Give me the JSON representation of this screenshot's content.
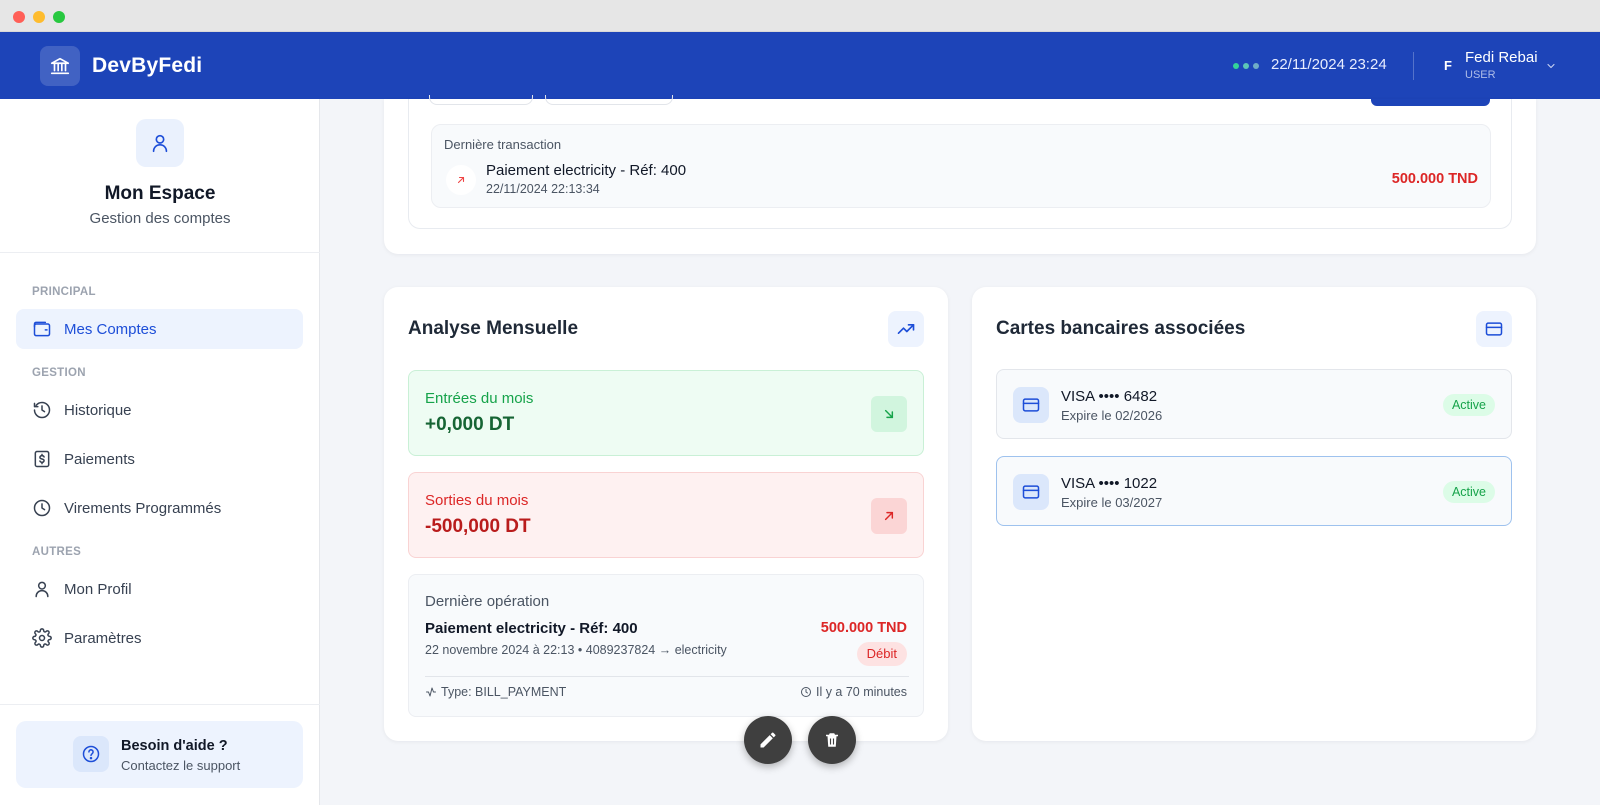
{
  "header": {
    "brand": "DevByFedi",
    "datetime": "22/11/2024 23:24",
    "user_initial": "F",
    "user_name": "Fedi Rebai",
    "user_role": "USER"
  },
  "sidebar": {
    "title": "Mon Espace",
    "subtitle": "Gestion des comptes",
    "sections": {
      "principal": "PRINCIPAL",
      "gestion": "GESTION",
      "autres": "AUTRES"
    },
    "items": {
      "comptes": "Mes Comptes",
      "historique": "Historique",
      "paiements": "Paiements",
      "virements": "Virements Programmés",
      "profil": "Mon Profil",
      "parametres": "Paramètres"
    },
    "help_title": "Besoin d'aide ?",
    "help_sub": "Contactez le support"
  },
  "last_transaction": {
    "label": "Dernière transaction",
    "title": "Paiement electricity - Réf: 400",
    "date": "22/11/2024 22:13:34",
    "amount": "500.000 TND"
  },
  "analyse": {
    "title": "Analyse Mensuelle",
    "entrees_label": "Entrées du mois",
    "entrees_value": "+0,000 DT",
    "sorties_label": "Sorties du mois",
    "sorties_value": "-500,000 DT",
    "op_label": "Dernière opération",
    "op_title": "Paiement electricity - Réf: 400",
    "op_amount": "500.000 TND",
    "op_meta": "22 novembre 2024 à 22:13  •  4089237824 → electricity",
    "op_badge": "Débit",
    "op_type": "Type: BILL_PAYMENT",
    "op_time": "Il y a 70 minutes"
  },
  "cartes": {
    "title": "Cartes bancaires associées",
    "items": [
      {
        "title": "VISA •••• 6482",
        "expiry": "Expire le 02/2026",
        "status": "Active"
      },
      {
        "title": "VISA •••• 1022",
        "expiry": "Expire le 03/2027",
        "status": "Active"
      }
    ]
  },
  "colors": {
    "primary": "#1d44b8",
    "danger": "#dc2626",
    "success": "#16a34a"
  }
}
